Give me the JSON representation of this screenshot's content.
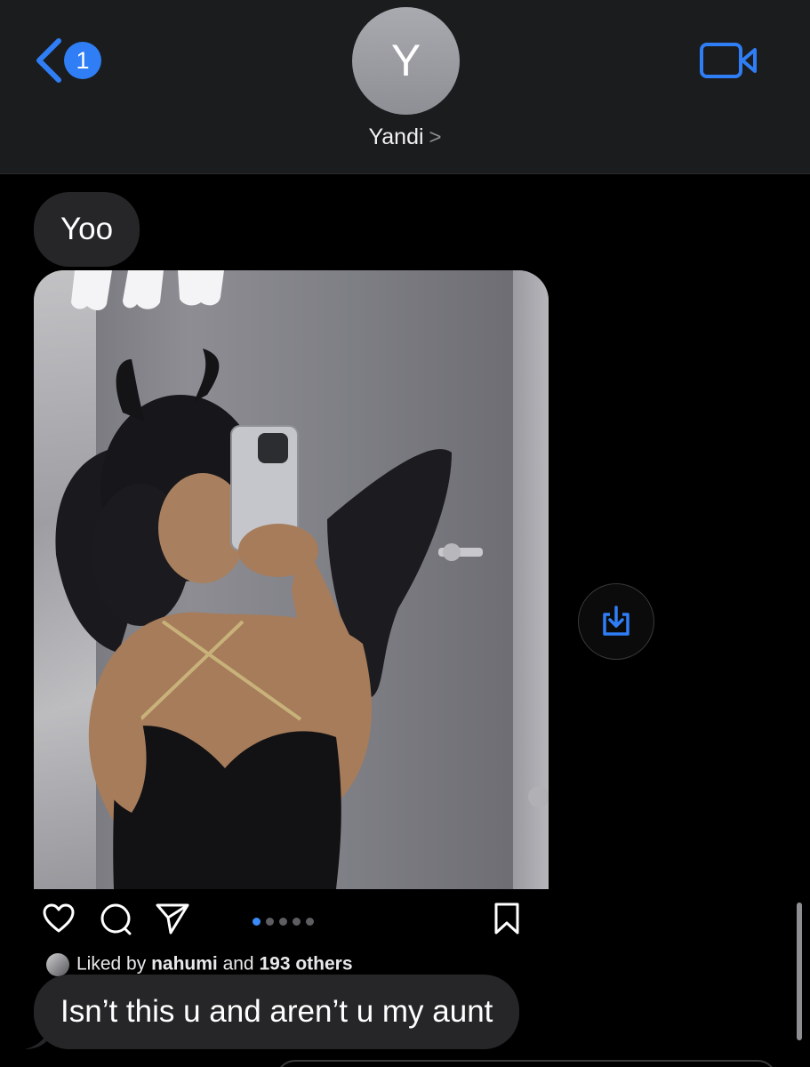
{
  "header": {
    "unread_count": "1",
    "avatar_initial": "Y",
    "contact_name": "Yandi",
    "name_chevron": ">",
    "back_icon": "chevron-left-icon",
    "video_icon": "video-camera-icon"
  },
  "messages": [
    {
      "sender": "incoming",
      "text": "Yoo"
    },
    {
      "sender": "incoming",
      "text": "Isn’t this u and aren’t u my aunt"
    }
  ],
  "post": {
    "liked_by_prefix": "Liked by",
    "liked_by_user": "nahumi",
    "liked_by_and": "and",
    "liked_by_others": "193 others",
    "carousel": {
      "total": 5,
      "current": 1
    },
    "icons": [
      "heart-icon",
      "comment-icon",
      "send-icon",
      "bookmark-icon"
    ]
  },
  "share": {
    "icon": "share-download-icon"
  },
  "colors": {
    "accent": "#2f7ef6",
    "bubble": "#262628",
    "header_bg": "#1b1c1e",
    "background": "#000000"
  }
}
